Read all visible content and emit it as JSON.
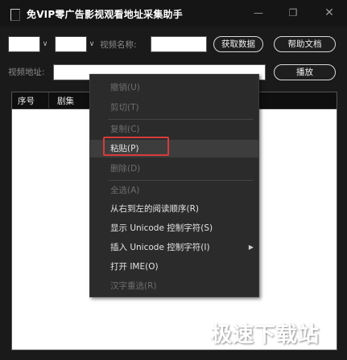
{
  "window": {
    "title": "免VIP零广告影视观看地址采集助手",
    "min_icon": "minimize-icon",
    "max_icon": "maximize-icon",
    "close_icon": "close-icon"
  },
  "toolbar": {
    "video_name_label": "视频名称:",
    "fetch_button": "获取数据",
    "help_button": "帮助文档",
    "video_url_label": "视频地址:",
    "play_button": "播放"
  },
  "table": {
    "columns": [
      "序号",
      "剧集"
    ]
  },
  "context_menu": {
    "items": [
      {
        "label": "撤销(U)",
        "enabled": false
      },
      {
        "label": "剪切(T)",
        "enabled": false
      },
      {
        "label": "复制(C)",
        "enabled": false
      },
      {
        "label": "粘贴(P)",
        "enabled": true
      },
      {
        "label": "删除(D)",
        "enabled": false
      },
      {
        "label": "全选(A)",
        "enabled": false
      },
      {
        "label": "从右到左的阅读顺序(R)",
        "enabled": true
      },
      {
        "label": "显示 Unicode 控制字符(S)",
        "enabled": true
      },
      {
        "label": "插入 Unicode 控制字符(I)",
        "enabled": true,
        "submenu": true
      },
      {
        "label": "打开 IME(O)",
        "enabled": true
      },
      {
        "label": "汉字重选(R)",
        "enabled": false
      }
    ]
  },
  "watermark": "极速下载站"
}
